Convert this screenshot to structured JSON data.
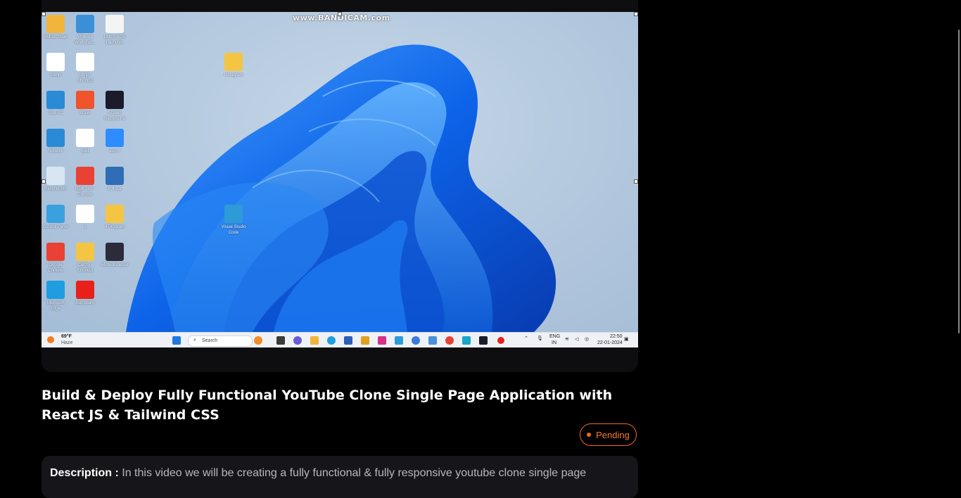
{
  "video": {
    "watermark": "www.BANDICAM.com",
    "desktop_icons": [
      {
        "label": "Rohan Shah",
        "icon": "user-folder-icon",
        "color": "#f2b53b"
      },
      {
        "label": "VMware Workstati...",
        "icon": "vmware-icon",
        "color": "#3b8fd8"
      },
      {
        "label": "Latest AOS Launcher",
        "icon": "settings-icon",
        "color": "#f4f4f4"
      },
      {
        "label": "comp",
        "icon": "json-file-icon",
        "color": "#ffffff"
      },
      {
        "label": "comp - Shortcut",
        "icon": "json-file-icon",
        "color": "#ffffff"
      },
      {
        "label": "This PC",
        "icon": "monitor-icon",
        "color": "#2b8ad6"
      },
      {
        "label": "Brave",
        "icon": "brave-icon",
        "color": "#f0542d"
      },
      {
        "label": "Screen Recorder d",
        "icon": "screen-recorder-icon",
        "color": "#1b1b2b"
      },
      {
        "label": "Network",
        "icon": "network-icon",
        "color": "#2b8ad6"
      },
      {
        "label": "split",
        "icon": "document-icon",
        "color": "#ffffff"
      },
      {
        "label": "Zoom",
        "icon": "zoom-icon",
        "color": "#2d8cff"
      },
      {
        "label": "Recycle Bin",
        "icon": "recycle-bin-icon",
        "color": "#d8e6f2"
      },
      {
        "label": "RDK 360 - Chrome",
        "icon": "chrome-icon",
        "color": "#e94235"
      },
      {
        "label": "R 4.3.2",
        "icon": "r-icon",
        "color": "#2f6eb5"
      },
      {
        "label": "Control Panel",
        "icon": "control-panel-icon",
        "color": "#3aa0e0"
      },
      {
        "label": "1",
        "icon": "document-icon",
        "color": "#ffffff"
      },
      {
        "label": "4 Program",
        "icon": "folder-icon",
        "color": "#f4c542"
      },
      {
        "label": "Google Chrome",
        "icon": "chrome-icon",
        "color": "#e94235"
      },
      {
        "label": "Carthy - Shortcut",
        "icon": "folder-icon",
        "color": "#f4c542"
      },
      {
        "label": "WinterBrowser",
        "icon": "w-icon",
        "color": "#2b2b3a"
      },
      {
        "label": "Microsoft Edge",
        "icon": "edge-icon",
        "color": "#1f9de0"
      },
      {
        "label": "Bandicam",
        "icon": "record-icon",
        "color": "#e8201a"
      },
      {
        "label": "Instagram",
        "icon": "folder-icon",
        "color": "#f4c542"
      },
      {
        "label": "Visual Studio Code",
        "icon": "vscode-icon",
        "color": "#2e9bd8"
      }
    ],
    "taskbar": {
      "weather_temp": "69°F",
      "weather_desc": "Haze",
      "search_placeholder": "Search",
      "lang_top": "ENG",
      "lang_bottom": "IN",
      "time": "22:50",
      "date": "22-01-2024"
    }
  },
  "title": "Build & Deploy Fully Functional YouTube Clone Single Page Application with React JS & Tailwind CSS",
  "status": {
    "label": "Pending",
    "color": "#f06a1e"
  },
  "description": {
    "label": "Description :",
    "text": "In this video we will be creating a fully functional & fully responsive youtube clone single page"
  }
}
